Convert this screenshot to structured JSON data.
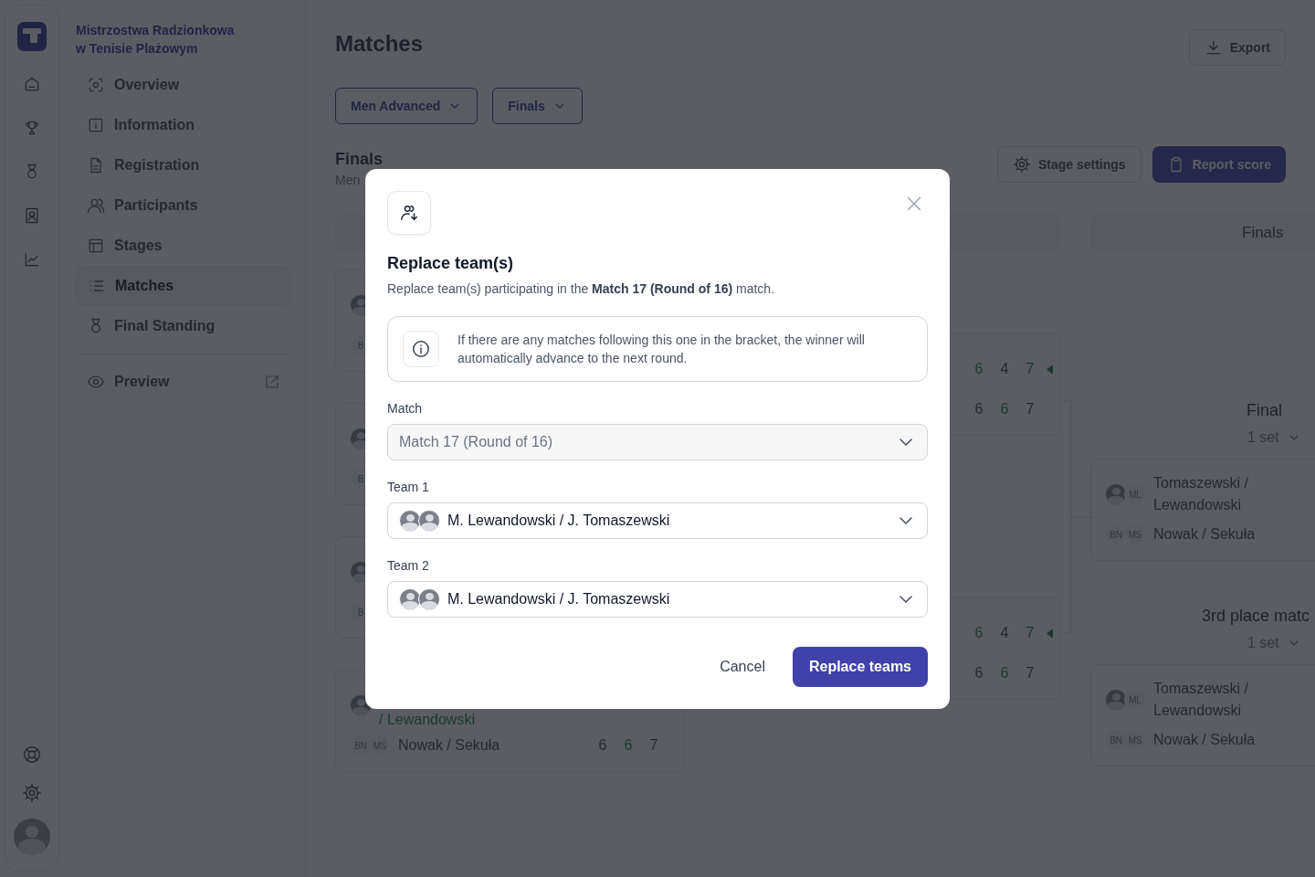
{
  "sidebar": {
    "title": "Mistrzostwa Radzionkowa w Tenisie Plażowym",
    "items": [
      {
        "label": "Overview",
        "selected": false
      },
      {
        "label": "Information",
        "selected": false
      },
      {
        "label": "Registration",
        "selected": false
      },
      {
        "label": "Participants",
        "selected": false
      },
      {
        "label": "Stages",
        "selected": false
      },
      {
        "label": "Matches",
        "selected": true
      },
      {
        "label": "Final Standing",
        "selected": false
      }
    ],
    "preview": {
      "label": "Preview"
    }
  },
  "page": {
    "title": "Matches",
    "export_button": "Export",
    "filters": [
      {
        "label": "Men Advanced"
      },
      {
        "label": "Finals"
      }
    ],
    "stage": {
      "title": "Finals",
      "subtitle": "Men"
    },
    "stage_settings_button": "Stage settings",
    "report_score_button": "Report score"
  },
  "bracket": {
    "columns": [
      {
        "matches": [
          {
            "teams": [
              {
                "avatars": [
                  {
                    "kind": "photo"
                  }
                ]
              },
              {
                "avatars": [
                  {
                    "kind": "initials",
                    "text": "B"
                  }
                ]
              }
            ]
          },
          {
            "teams": [
              {
                "avatars": [
                  {
                    "kind": "photo"
                  }
                ]
              },
              {
                "avatars": [
                  {
                    "kind": "initials",
                    "text": "B"
                  }
                ]
              }
            ]
          },
          {
            "teams": [
              {
                "avatars": [
                  {
                    "kind": "photo"
                  }
                ]
              },
              {
                "avatars": [
                  {
                    "kind": "initials",
                    "text": "B"
                  }
                ]
              }
            ]
          },
          {
            "teams": [
              {
                "avatars": [
                  {
                    "kind": "photo"
                  }
                ],
                "name": "/ Lewandowski",
                "winner": true
              },
              {
                "avatars": [
                  {
                    "kind": "initials",
                    "text": "BN"
                  },
                  {
                    "kind": "initials",
                    "text": "MS"
                  }
                ],
                "name": "Nowak / Sekuła",
                "winner": false,
                "scores": [
                  {
                    "value": "6",
                    "won": false
                  },
                  {
                    "value": "6",
                    "won": true
                  },
                  {
                    "value": "7",
                    "won": false
                  }
                ]
              }
            ]
          }
        ]
      },
      {
        "matches": [
          {
            "teams": [
              {
                "scores": [
                  {
                    "value": "6",
                    "won": true
                  },
                  {
                    "value": "4",
                    "won": false
                  },
                  {
                    "value": "7",
                    "won": true
                  }
                ],
                "marker": true
              },
              {
                "scores": [
                  {
                    "value": "6",
                    "won": false
                  },
                  {
                    "value": "6",
                    "won": true
                  },
                  {
                    "value": "7",
                    "won": false
                  }
                ]
              }
            ]
          },
          {
            "teams": [
              {
                "scores": [
                  {
                    "value": "6",
                    "won": true
                  },
                  {
                    "value": "4",
                    "won": false
                  },
                  {
                    "value": "7",
                    "won": true
                  }
                ],
                "marker": true
              },
              {
                "scores": [
                  {
                    "value": "6",
                    "won": false
                  },
                  {
                    "value": "6",
                    "won": true
                  },
                  {
                    "value": "7",
                    "won": false
                  }
                ]
              }
            ]
          }
        ]
      },
      {
        "header": "Finals",
        "matches": [
          {
            "title": "Final",
            "sets": "1 set",
            "teams": [
              {
                "avatars": [
                  {
                    "kind": "photo"
                  },
                  {
                    "kind": "initials",
                    "text": "ML"
                  }
                ],
                "name": "Tomaszewski / Lewandowski",
                "winner": false
              },
              {
                "avatars": [
                  {
                    "kind": "initials",
                    "text": "BN"
                  },
                  {
                    "kind": "initials",
                    "text": "MS"
                  }
                ],
                "name": "Nowak / Sekuła",
                "winner": false
              }
            ]
          },
          {
            "title": "3rd place matc",
            "sets": "1 set",
            "teams": [
              {
                "avatars": [
                  {
                    "kind": "photo"
                  },
                  {
                    "kind": "initials",
                    "text": "ML"
                  }
                ],
                "name": "Tomaszewski / Lewandowski",
                "winner": false
              },
              {
                "avatars": [
                  {
                    "kind": "initials",
                    "text": "BN"
                  },
                  {
                    "kind": "initials",
                    "text": "MS"
                  }
                ],
                "name": "Nowak / Sekuła",
                "winner": false
              }
            ]
          }
        ]
      }
    ]
  },
  "modal": {
    "title": "Replace team(s)",
    "description": "Replace team(s) participating in the **Match 17 (Round of 16)** match.",
    "notice": "If there are any matches following this one in the bracket, the winner will automatically advance to the next round.",
    "fields": [
      {
        "label": "Match",
        "value": "Match 17 (Round of 16)",
        "disabled": true
      },
      {
        "label": "Team 1",
        "value": "M. Lewandowski / J. Tomaszewski",
        "disabled": false,
        "avatars": [
          {
            "kind": "photo"
          },
          {
            "kind": "photo"
          }
        ]
      },
      {
        "label": "Team 2",
        "value": "M. Lewandowski / J. Tomaszewski",
        "disabled": false,
        "avatars": [
          {
            "kind": "photo"
          },
          {
            "kind": "photo"
          }
        ]
      }
    ],
    "cancel_button": "Cancel",
    "confirm_button": "Replace teams"
  }
}
